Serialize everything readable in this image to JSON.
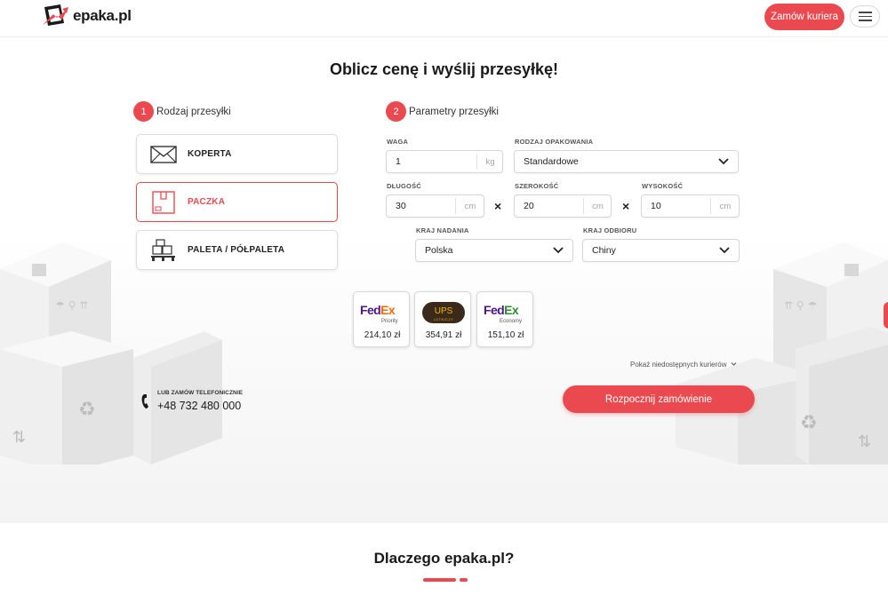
{
  "header": {
    "logo_text": "epaka.pl",
    "order_courier_label": "Zamów kuriera"
  },
  "page": {
    "title": "Oblicz cenę i wyślij przesyłkę!"
  },
  "step1": {
    "number": "1",
    "label": "Rodzaj przesyłki",
    "types": [
      {
        "label": "KOPERTA",
        "icon": "envelope-icon",
        "active": false
      },
      {
        "label": "PACZKA",
        "icon": "package-icon",
        "active": true
      },
      {
        "label": "PALETA / PÓŁPALETA",
        "icon": "pallet-icon",
        "active": false
      }
    ]
  },
  "step2": {
    "number": "2",
    "label": "Parametry przesyłki",
    "weight": {
      "label": "WAGA",
      "value": "1",
      "unit": "kg"
    },
    "packaging": {
      "label": "RODZAJ OPAKOWANIA",
      "value": "Standardowe"
    },
    "length": {
      "label": "DŁUGOŚĆ",
      "value": "30",
      "unit": "cm"
    },
    "width": {
      "label": "SZEROKOŚĆ",
      "value": "20",
      "unit": "cm"
    },
    "height": {
      "label": "WYSOKOŚĆ",
      "value": "10",
      "unit": "cm"
    },
    "origin_country": {
      "label": "KRAJ NADANIA",
      "value": "Polska"
    },
    "destination_country": {
      "label": "KRAJ ODBIORU",
      "value": "Chiny"
    },
    "times_symbol": "×"
  },
  "couriers": [
    {
      "brand_a": "Fed",
      "brand_b": "Ex",
      "service": "Priority",
      "price": "214,10 zł"
    },
    {
      "brand": "UPS",
      "service": "LOTNICZY",
      "price": "354,91 zł"
    },
    {
      "brand_a": "Fed",
      "brand_b": "Ex",
      "service": "Economy",
      "price": "151,10 zł"
    }
  ],
  "show_unavailable_label": "Pokaż niedostępnych kurierów",
  "phone": {
    "caption": "LUB ZAMÓW TELEFONICZNIE",
    "number": "+48 732 480 000"
  },
  "start_order_label": "Rozpocznij zamówienie",
  "why": {
    "title": "Dlaczego epaka.pl?"
  },
  "colors": {
    "accent": "#ea4a4f",
    "fedex_purple": "#4d148c",
    "fedex_orange": "#ff6600",
    "fedex_green": "#2e8b2e",
    "ups_brown": "#3b2a1a",
    "ups_gold": "#f5b400"
  }
}
